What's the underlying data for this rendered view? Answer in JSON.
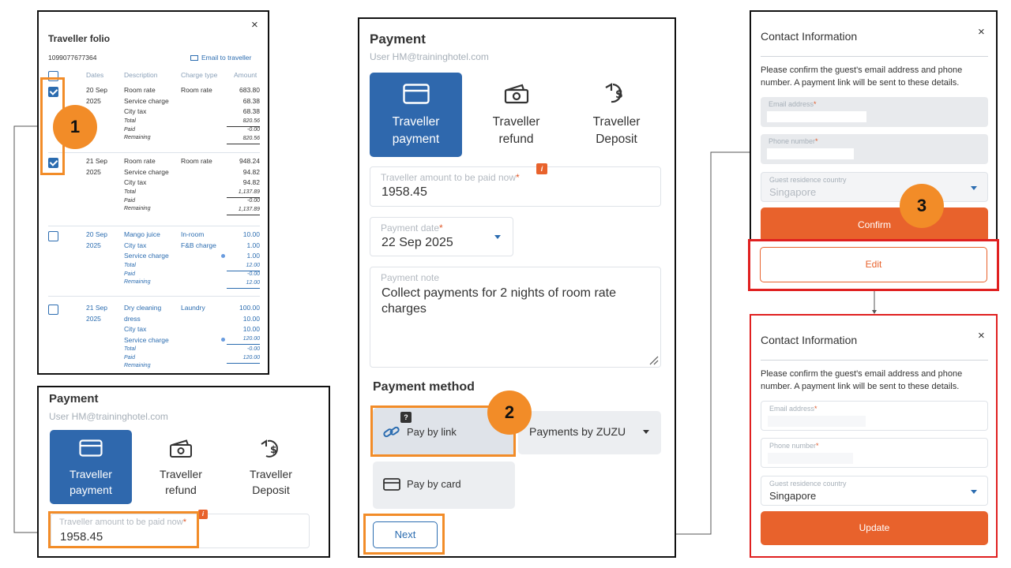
{
  "folio": {
    "title": "Traveller folio",
    "account": "1099077677364",
    "email_link": "Email to traveller",
    "close": "×",
    "headers": {
      "dates": "Dates",
      "description": "Description",
      "charge_type": "Charge type",
      "amount": "Amount"
    },
    "rows": [
      {
        "checked": true,
        "date": "20 Sep\n2025",
        "desc": "Room rate\nService charge\nCity tax",
        "type": "Room rate",
        "amounts": "683.80\n68.38\n68.38",
        "sum_labels": "Total\nPaid\nRemaining",
        "sums": [
          "820.56",
          "-0.00",
          "820.56"
        ]
      },
      {
        "checked": true,
        "date": "21 Sep\n2025",
        "desc": "Room rate\nService charge\nCity tax",
        "type": "Room rate",
        "amounts": "948.24\n94.82\n94.82",
        "sum_labels": "Total\nPaid\nRemaining",
        "sums": [
          "1,137.89",
          "-0.00",
          "1,137.89"
        ]
      },
      {
        "checked": false,
        "date": "20 Sep\n2025",
        "desc": "Mango juice\nCity tax\nService charge",
        "type": "In-room\nF&B charge",
        "amounts": "10.00\n1.00\n1.00",
        "sum_labels": "Total\nPaid\nRemaining",
        "sums": [
          "12.00",
          "-0.00",
          "12.00"
        ]
      },
      {
        "checked": false,
        "date": "21 Sep\n2025",
        "desc": "Dry cleaning\ndress\nCity tax\nService charge",
        "type": "Laundry",
        "amounts": "100.00\n10.00\n10.00",
        "sum_labels": "Total\nPaid\nRemaining",
        "sums": [
          "120.00",
          "-0.00",
          "120.00"
        ]
      }
    ]
  },
  "payment": {
    "title": "Payment",
    "user": "User HM@traininghotel.com",
    "tiles": [
      {
        "line1": "Traveller",
        "line2": "payment",
        "icon": "card-icon"
      },
      {
        "line1": "Traveller",
        "line2": "refund",
        "icon": "cash-icon"
      },
      {
        "line1": "Traveller",
        "line2": "Deposit",
        "icon": "dollar-return-icon"
      }
    ],
    "amount_label": "Traveller amount to be paid now",
    "amount_value": "1958.45",
    "date_label": "Payment date",
    "date_value": "22 Sep 2025",
    "note_label": "Payment note",
    "note_value": "Collect payments for 2 nights of room rate charges",
    "method_title": "Payment method",
    "pay_link": "Pay by link",
    "pay_card": "Pay by card",
    "provider": "Payments by ZUZU",
    "next": "Next",
    "info_badge": "i",
    "help_badge": "?"
  },
  "contact": {
    "title": "Contact Information",
    "close": "×",
    "desc_line1": "Please confirm the guest's email address and phone",
    "desc_line2": "number. A payment link will be sent to these details.",
    "email_label": "Email address",
    "phone_label": "Phone number",
    "country_label": "Guest residence country",
    "country_value": "Singapore",
    "confirm": "Confirm",
    "edit": "Edit",
    "update": "Update",
    "req": "*"
  },
  "steps": {
    "one": "1",
    "two": "2",
    "three": "3"
  },
  "colors": {
    "primary_blue": "#2f68ad",
    "accent_orange": "#e8622c",
    "highlight_orange": "#f28c28",
    "highlight_red": "#e02020"
  }
}
